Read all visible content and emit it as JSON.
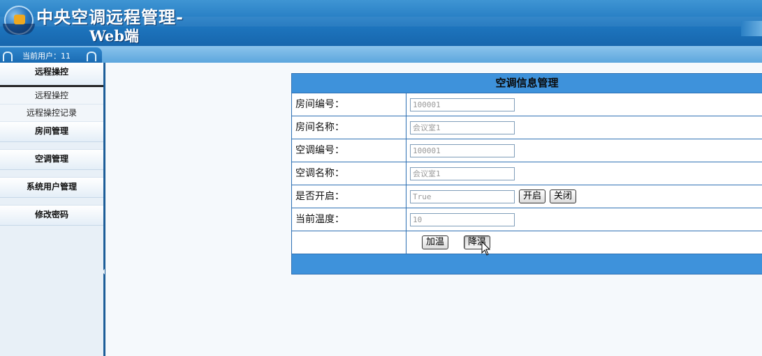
{
  "header": {
    "title_line1": "中央空调远程管理-",
    "title_line2": "Web端"
  },
  "userbar": {
    "current_user": "当前用户：11"
  },
  "sidebar": {
    "sections": [
      {
        "label": "远程操控",
        "items": [
          "远程操控",
          "远程操控记录"
        ]
      },
      {
        "label": "房间管理"
      },
      {
        "label": "空调管理"
      },
      {
        "label": "系统用户管理"
      },
      {
        "label": "修改密码"
      }
    ]
  },
  "panel": {
    "title": "空调信息管理",
    "fields": [
      {
        "label": "房间编号：",
        "value": "100001"
      },
      {
        "label": "房间名称：",
        "value": "会议室1"
      },
      {
        "label": "空调编号：",
        "value": "100001"
      },
      {
        "label": "空调名称：",
        "value": "会议室1"
      },
      {
        "label": "是否开启：",
        "value": "True"
      },
      {
        "label": "当前温度：",
        "value": "10"
      }
    ],
    "buttons": {
      "open": "开启",
      "close": "关闭",
      "increase_temp": "加温",
      "decrease_temp": "降温"
    }
  }
}
